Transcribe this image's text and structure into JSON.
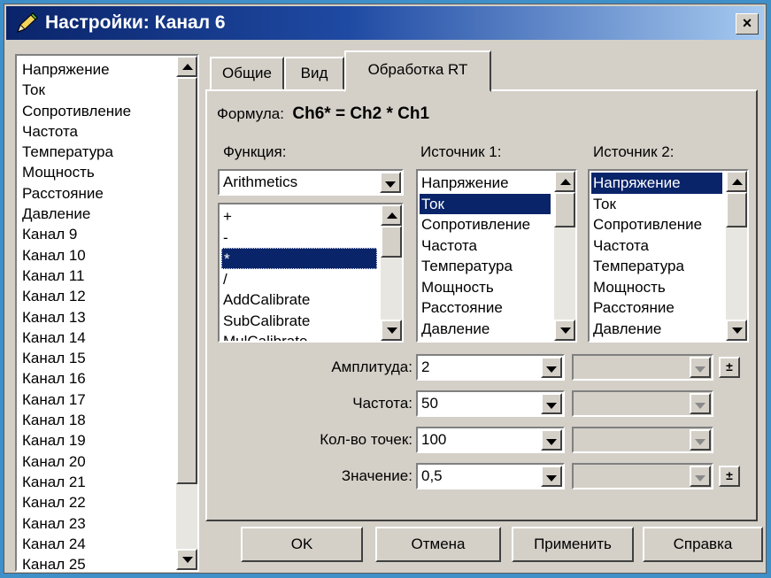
{
  "window": {
    "title": "Настройки: Канал 6",
    "close_label": "×"
  },
  "channel_list": {
    "items": [
      "Напряжение",
      "Ток",
      "Сопротивление",
      "Частота",
      "Температура",
      "Мощность",
      "Расстояние",
      "Давление",
      "Канал 9",
      "Канал 10",
      "Канал 11",
      "Канал 12",
      "Канал 13",
      "Канал 14",
      "Канал 15",
      "Канал 16",
      "Канал 17",
      "Канал 18",
      "Канал 19",
      "Канал 20",
      "Канал 21",
      "Канал 22",
      "Канал 23",
      "Канал 24",
      "Канал 25"
    ],
    "selected": "Мощность"
  },
  "tabs": [
    {
      "label": "Общие"
    },
    {
      "label": "Вид"
    },
    {
      "label": "Обработка RT",
      "active": true
    }
  ],
  "formula": {
    "label": "Формула:",
    "value": "Ch6* = Ch2 * Ch1"
  },
  "function": {
    "label": "Функция:",
    "combo_value": "Arithmetics",
    "items": [
      "+",
      "-",
      "*",
      "/",
      "AddCalibrate",
      "SubCalibrate",
      "MulCalibrate"
    ],
    "selected": "*"
  },
  "source1": {
    "label": "Источник 1:",
    "items": [
      "Напряжение",
      "Ток",
      "Сопротивление",
      "Частота",
      "Температура",
      "Мощность",
      "Расстояние",
      "Давление"
    ],
    "selected": "Ток"
  },
  "source2": {
    "label": "Источник 2:",
    "items": [
      "Напряжение",
      "Ток",
      "Сопротивление",
      "Частота",
      "Температура",
      "Мощность",
      "Расстояние",
      "Давление"
    ],
    "selected": "Напряжение"
  },
  "params": [
    {
      "label": "Амплитуда:",
      "value": "2",
      "has_toggle": true
    },
    {
      "label": "Частота:",
      "value": "50",
      "has_toggle": false
    },
    {
      "label": "Кол-во точек:",
      "value": "100",
      "has_toggle": false
    },
    {
      "label": "Значение:",
      "value": "0,5",
      "has_toggle": true
    }
  ],
  "toggle_symbol": "±",
  "buttons": {
    "ok": "OK",
    "cancel": "Отмена",
    "apply": "Применить",
    "help": "Справка"
  },
  "colors": {
    "selection": "#0a246a",
    "face": "#d4d0c8",
    "desktop": "#3f8fc9"
  }
}
